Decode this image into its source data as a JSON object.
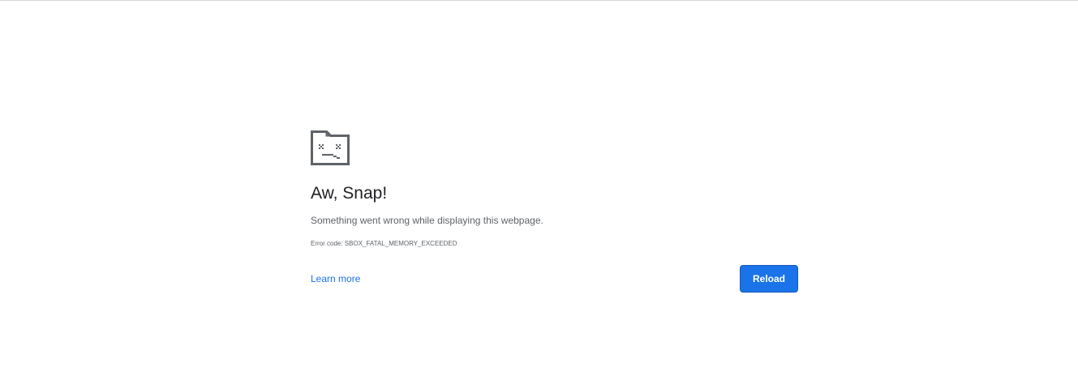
{
  "error_page": {
    "icon": "sad-tab-icon",
    "heading": "Aw, Snap!",
    "message": "Something went wrong while displaying this webpage.",
    "error_code": "Error code: SBOX_FATAL_MEMORY_EXCEEDED",
    "learn_more_label": "Learn more",
    "reload_label": "Reload"
  },
  "colors": {
    "background": "#ffffff",
    "heading": "#202124",
    "body_text": "#5f6368",
    "link": "#1a73e8",
    "button": "#1a73e8",
    "button_text": "#ffffff",
    "icon": "#5f6368"
  }
}
